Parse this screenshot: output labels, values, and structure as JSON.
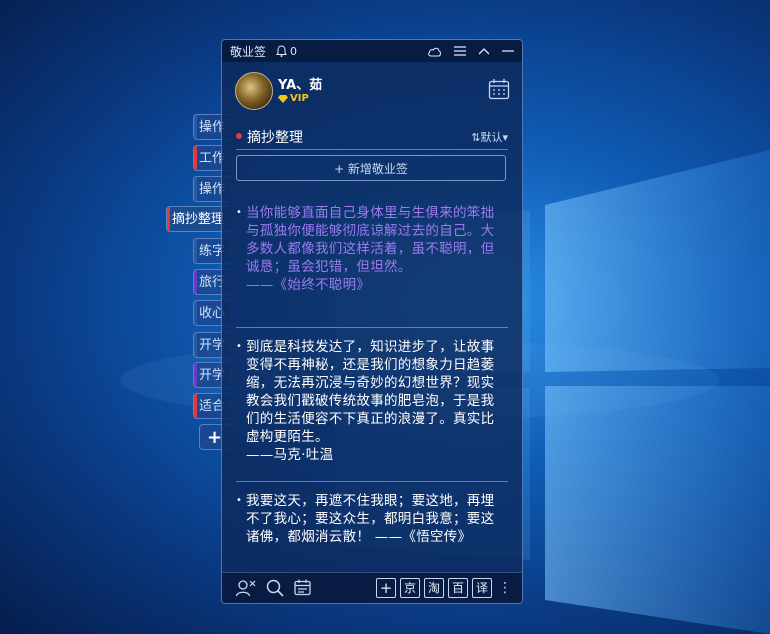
{
  "app": {
    "title": "敬业签",
    "notification_count": "0"
  },
  "user": {
    "name": "YA、茹",
    "badge": "VIP"
  },
  "section": {
    "name": "摘抄整理",
    "sort_label": "默认"
  },
  "add_button": "+ 新增敬业签",
  "tabs": [
    {
      "label": "操作",
      "color": "#2c5aa0"
    },
    {
      "label": "工作",
      "color": "#e23a3a"
    },
    {
      "label": "操作",
      "color": "#2c5aa0"
    },
    {
      "label": "摘抄整理",
      "color": "#e23a3a",
      "active": true
    },
    {
      "label": "练字",
      "color": "#2c5aa0"
    },
    {
      "label": "旅行",
      "color": "#6a3acb"
    },
    {
      "label": "收心",
      "color": "#2c5aa0"
    },
    {
      "label": "开学",
      "color": "#2c5aa0"
    },
    {
      "label": "开学",
      "color": "#6a3acb"
    },
    {
      "label": "适合",
      "color": "#e23a3a"
    }
  ],
  "add_tab": "+",
  "notes": [
    {
      "text": "当你能够直面自己身体里与生俱来的笨拙与孤独你便能够彻底谅解过去的自己。大多数人都像我们这样活着，虽不聪明，但诚恳；虽会犯错，但坦然。",
      "source": "——《始终不聪明》",
      "style": "purple"
    },
    {
      "text": "到底是科技发达了，知识进步了，让故事变得不再神秘，还是我们的想象力日趋萎缩，无法再沉浸与奇妙的幻想世界？现实教会我们戳破传统故事的肥皂泡，于是我们的生活便容不下真正的浪漫了。真实比虚构更陌生。",
      "source": "——马克·吐温",
      "style": "white"
    },
    {
      "text": "我要这天，再遮不住我眼；要这地，再埋不了我心；要这众生，都明白我意；要这诸佛，都烟消云散！ ——《悟空传》",
      "source": "",
      "style": "white"
    }
  ],
  "toolbar": {
    "tools": [
      "+",
      "京",
      "淘",
      "百",
      "译"
    ]
  },
  "colors": {
    "accent": "#e23a3a",
    "purple_text": "#9b7cf0",
    "vip_gold": "#f5c518"
  }
}
